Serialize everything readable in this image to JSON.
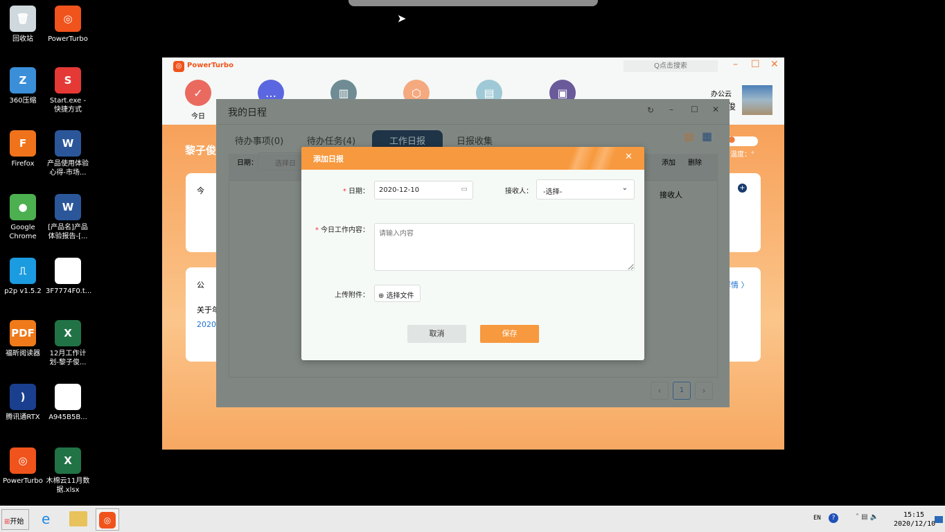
{
  "desktop": {
    "icons_col1": [
      {
        "label": "回收站",
        "icon": "recycle-bin-icon",
        "color": "#cfd8dc",
        "glyph": "🗑"
      },
      {
        "label": "360压缩",
        "icon": "archive-icon",
        "color": "#3a8fd8",
        "glyph": "Z"
      },
      {
        "label": "Firefox",
        "icon": "firefox-icon",
        "color": "#f0731b",
        "glyph": "F"
      },
      {
        "label": "Google Chrome",
        "icon": "chrome-icon",
        "color": "#4caf50",
        "glyph": "●"
      },
      {
        "label": "p2p v1.5.2",
        "icon": "p2p-icon",
        "color": "#1b9be0",
        "glyph": "⎍"
      },
      {
        "label": "福昕阅读器",
        "icon": "pdf-reader-icon",
        "color": "#f07a1a",
        "glyph": "PDF"
      },
      {
        "label": "腾讯通RTX",
        "icon": "rtx-icon",
        "color": "#1b3f8f",
        "glyph": ")"
      },
      {
        "label": "PowerTurbo",
        "icon": "powerturbo-icon",
        "color": "#f0531b",
        "glyph": "◎"
      }
    ],
    "icons_col2": [
      {
        "label": "PowerTurbo",
        "icon": "powerturbo-icon",
        "color": "#f0531b",
        "glyph": "◎"
      },
      {
        "label": "Start.exe - 快捷方式",
        "icon": "start-exe-icon",
        "color": "#e53935",
        "glyph": "S"
      },
      {
        "label": "产品使用体验心得-市场...",
        "icon": "word-doc-icon",
        "color": "#2b579a",
        "glyph": "W"
      },
      {
        "label": "[产品名]产品体验报告-[...",
        "icon": "word-doc-icon",
        "color": "#2b579a",
        "glyph": "W"
      },
      {
        "label": "3F7774F0.t...",
        "icon": "file-icon",
        "color": "#ffffff",
        "glyph": ""
      },
      {
        "label": "12月工作计划-黎子俊...",
        "icon": "excel-icon",
        "color": "#217346",
        "glyph": "X"
      },
      {
        "label": "A945B5B...",
        "icon": "file-icon",
        "color": "#ffffff",
        "glyph": ""
      },
      {
        "label": "木棉云11月数据.xlsx",
        "icon": "excel-icon",
        "color": "#217346",
        "glyph": "X"
      }
    ]
  },
  "app": {
    "title": "PowerTurbo",
    "search_placeholder": "Q点击搜索",
    "nav": [
      {
        "label": "今日",
        "color": "#ea6a60",
        "glyph": "✓"
      },
      {
        "label": "",
        "color": "#5b67e0",
        "glyph": "…"
      },
      {
        "label": "",
        "color": "#6f8c94",
        "glyph": "▥"
      },
      {
        "label": "",
        "color": "#f5a97f",
        "glyph": "⬡"
      },
      {
        "label": "",
        "color": "#9fc9d6",
        "glyph": "▤"
      },
      {
        "label": "",
        "color": "#6a5a9a",
        "glyph": "▣"
      }
    ],
    "user_line1": "办公云",
    "user_line2": "俊",
    "greeting": "黎子俊",
    "weather": "温度：°",
    "card1_title": "今",
    "card2_title": "公",
    "card2_line1": "关于年",
    "card2_line2": "2020",
    "details_link": "详情 〉"
  },
  "schedule": {
    "title": "我的日程",
    "tabs": [
      "待办事项(0)",
      "待办任务(4)",
      "工作日报",
      "日报收集"
    ],
    "active_tab": 2,
    "date_label": "日期：",
    "date_placeholder": "选择日",
    "add": "添加",
    "delete": "删除",
    "col_receiver": "接收人",
    "page": "1"
  },
  "dialog": {
    "title": "添加日报",
    "date_label": "日期：",
    "date_value": "2020-12-10",
    "receiver_label": "接收人：",
    "receiver_value": "-选择-",
    "content_label": "今日工作内容：",
    "content_placeholder": "请输入内容",
    "attach_label": "上传附件：",
    "attach_button": "选择文件",
    "cancel": "取消",
    "save": "保存"
  },
  "taskbar": {
    "start": "开始",
    "lang": "EN",
    "time": "15:15",
    "date": "2020/12/10"
  }
}
